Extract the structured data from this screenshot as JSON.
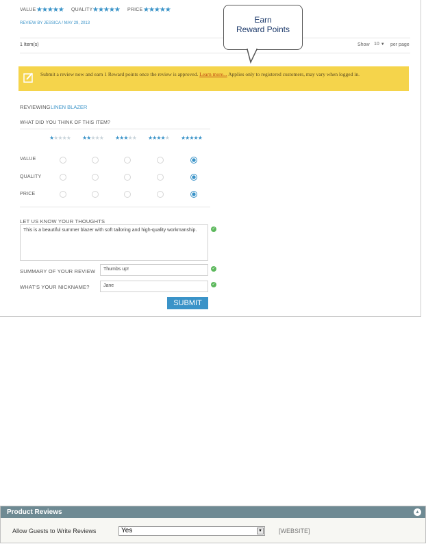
{
  "review": {
    "ratings": [
      {
        "label": "VALUE",
        "stars": "★★★★★"
      },
      {
        "label": "QUALITY",
        "stars": "★★★★★"
      },
      {
        "label": "PRICE",
        "stars": "★★★★★"
      }
    ],
    "byline": "REVIEW BY JESSICA / MAY 29, 2013"
  },
  "toolbar": {
    "items": "1 Item(s)",
    "show_label": "Show",
    "per_page": "10",
    "per_page_suffix": "per page"
  },
  "callout": {
    "line1": "Earn",
    "line2": "Reward Points"
  },
  "notice": {
    "text": "Submit a review now and earn 1 Reward points once the review is approved.",
    "link": "Learn more...",
    "tail": "Applies only to registered customers, may vary when logged in.",
    "bg": "#f5d44b"
  },
  "form": {
    "reviewing_label": "REVIEWING",
    "product": "LINEN BLAZER",
    "question": "WHAT DID YOU THINK OF THIS ITEM?",
    "rating_rows": [
      "VALUE",
      "QUALITY",
      "PRICE"
    ],
    "thoughts_label": "LET US KNOW YOUR THOUGHTS",
    "thoughts_value": "This is a beautiful summer blazer with soft tailoring and high-quality workmanship.",
    "summary_label": "SUMMARY OF YOUR REVIEW",
    "summary_value": "Thumbs up!",
    "nickname_label": "WHAT'S YOUR NICKNAME?",
    "nickname_value": "Jane",
    "submit": "SUBMIT",
    "accent": "#3a93c8"
  },
  "config": {
    "header": "Product Reviews",
    "field_label": "Allow Guests to Write Reviews",
    "field_value": "Yes",
    "scope": "[WEBSITE]"
  }
}
